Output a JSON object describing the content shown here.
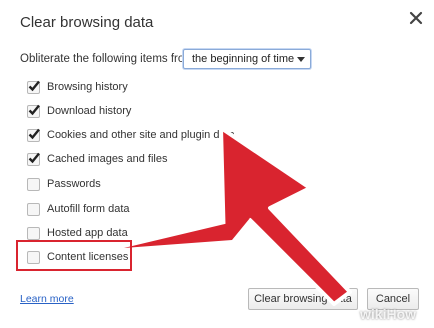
{
  "dialog": {
    "title": "Clear browsing data",
    "obliterate_label": "Obliterate the following items from:",
    "time_range": "the beginning of time"
  },
  "items": [
    {
      "label": "Browsing history",
      "checked": true
    },
    {
      "label": "Download history",
      "checked": true
    },
    {
      "label": "Cookies and other site and plugin data",
      "checked": true
    },
    {
      "label": "Cached images and files",
      "checked": true
    },
    {
      "label": "Passwords",
      "checked": false
    },
    {
      "label": "Autofill form data",
      "checked": false
    },
    {
      "label": "Hosted app data",
      "checked": false
    },
    {
      "label": "Content licenses",
      "checked": false
    }
  ],
  "footer": {
    "learn_more": "Learn more",
    "clear_button": "Clear browsing data",
    "cancel_button": "Cancel"
  },
  "watermark": {
    "prefix": "wiki",
    "suffix": "How"
  },
  "colors": {
    "annotation": "#d9242f",
    "link": "#2962c6",
    "checkmark": "#222222"
  },
  "icons": {
    "close": "close-icon",
    "arrow": "red-arrow-annotation",
    "caret": "chevron-down-icon"
  }
}
